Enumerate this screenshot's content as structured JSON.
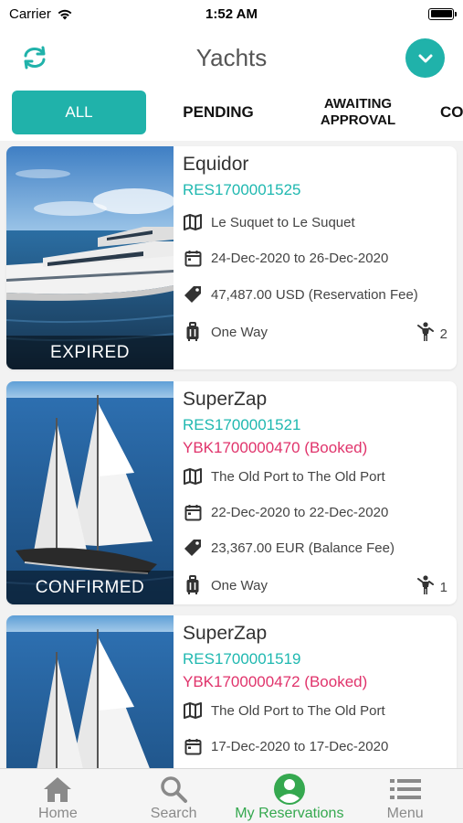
{
  "status_bar": {
    "carrier": "Carrier",
    "time": "1:52 AM"
  },
  "header": {
    "title": "Yachts",
    "accent": "#20b2aa"
  },
  "tabs": [
    {
      "label": "ALL",
      "active": true
    },
    {
      "label": "PENDING",
      "active": false
    },
    {
      "label": "AWAITING APPROVAL",
      "active": false
    },
    {
      "label": "CO",
      "active": false
    }
  ],
  "reservations": [
    {
      "name": "Equidor",
      "res_id": "RES1700001525",
      "booking": "",
      "route": "Le Suquet to Le Suquet",
      "dates": "24-Dec-2020 to 26-Dec-2020",
      "fee": "47,487.00 USD (Reservation Fee)",
      "trip": "One Way",
      "passengers": "2",
      "status": "EXPIRED",
      "image": "motor-yacht-image"
    },
    {
      "name": "SuperZap",
      "res_id": "RES1700001521",
      "booking": "YBK1700000470 (Booked)",
      "route": "The Old Port to The Old Port",
      "dates": "22-Dec-2020 to 22-Dec-2020",
      "fee": "23,367.00 EUR (Balance Fee)",
      "trip": "One Way",
      "passengers": "1",
      "status": "CONFIRMED",
      "image": "sailing-yacht-image"
    },
    {
      "name": "SuperZap",
      "res_id": "RES1700001519",
      "booking": "YBK1700000472 (Booked)",
      "route": "The Old Port to The Old Port",
      "dates": "17-Dec-2020 to 17-Dec-2020",
      "image": "sailing-yacht-image"
    }
  ],
  "colors": {
    "res_id": "#1fb8b0",
    "booking": "#e0336b",
    "active_tab": "#35a84f"
  },
  "tabbar": [
    {
      "label": "Home",
      "icon": "home-icon",
      "active": false
    },
    {
      "label": "Search",
      "icon": "search-icon",
      "active": false
    },
    {
      "label": "My Reservations",
      "icon": "profile-icon",
      "active": true
    },
    {
      "label": "Menu",
      "icon": "menu-icon",
      "active": false
    }
  ]
}
